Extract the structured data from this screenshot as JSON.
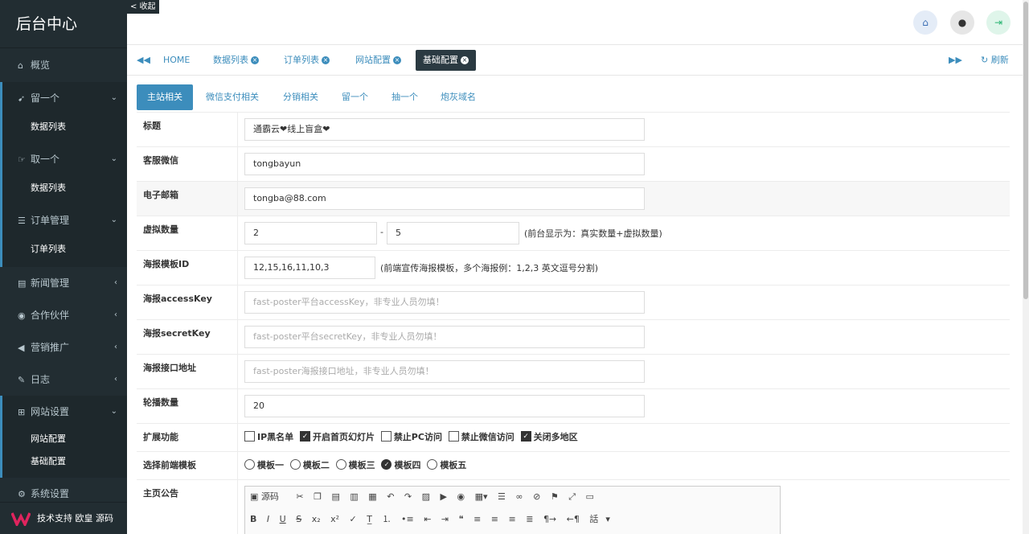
{
  "sidebar": {
    "brand": "后台中心",
    "items": [
      {
        "label": "概览",
        "icon": "home-icon"
      },
      {
        "label": "留一个",
        "icon": "paper-plane-icon",
        "sub": "数据列表"
      },
      {
        "label": "取一个",
        "icon": "hand-icon",
        "sub": "数据列表"
      },
      {
        "label": "订单管理",
        "icon": "list-icon",
        "sub": "订单列表"
      },
      {
        "label": "新闻管理",
        "icon": "newspaper-icon"
      },
      {
        "label": "合作伙伴",
        "icon": "eye-icon"
      },
      {
        "label": "营销推广",
        "icon": "megaphone-icon"
      },
      {
        "label": "日志",
        "icon": "edit-icon"
      },
      {
        "label": "网站设置",
        "icon": "sitemap-icon",
        "subs": [
          "网站配置",
          "基础配置"
        ]
      },
      {
        "label": "系统设置",
        "icon": "gear-icon"
      }
    ],
    "footer": "技术支持 欧皇 源码"
  },
  "header": {
    "collapse": "< 收起"
  },
  "tabs": {
    "home": "HOME",
    "items": [
      "数据列表",
      "订单列表",
      "网站配置",
      "基础配置"
    ],
    "refresh": "刷新"
  },
  "subtabs": [
    "主站相关",
    "微信支付相关",
    "分销相关",
    "留一个",
    "抽一个",
    "炮灰域名"
  ],
  "form": {
    "title": {
      "label": "标题",
      "value": "通霸云❤线上盲盒❤"
    },
    "wechat": {
      "label": "客服微信",
      "value": "tongbayun"
    },
    "email": {
      "label": "电子邮箱",
      "value": "tongba@88.com"
    },
    "virtual": {
      "label": "虚拟数量",
      "min": "2",
      "sep": "-",
      "max": "5",
      "note": "(前台显示为：真实数量+虚拟数量)"
    },
    "poster_id": {
      "label": "海报模板ID",
      "value": "12,15,16,11,10,3",
      "note": "(前端宣传海报模板，多个海报例：1,2,3 英文逗号分割)"
    },
    "access_key": {
      "label": "海报accessKey",
      "placeholder": "fast-poster平台accessKey，非专业人员勿填！"
    },
    "secret_key": {
      "label": "海报secretKey",
      "placeholder": "fast-poster平台secretKey，非专业人员勿填！"
    },
    "poster_api": {
      "label": "海报接口地址",
      "placeholder": "fast-poster海报接口地址，非专业人员勿填！"
    },
    "carousel": {
      "label": "轮播数量",
      "value": "20"
    },
    "extensions": {
      "label": "扩展功能",
      "options": [
        {
          "text": "IP黑名单",
          "checked": false
        },
        {
          "text": "开启首页幻灯片",
          "checked": true
        },
        {
          "text": "禁止PC访问",
          "checked": false
        },
        {
          "text": "禁止微信访问",
          "checked": false
        },
        {
          "text": "关闭多地区",
          "checked": true
        }
      ]
    },
    "template": {
      "label": "选择前端模板",
      "options": [
        {
          "text": "模板一",
          "checked": false
        },
        {
          "text": "模板二",
          "checked": false
        },
        {
          "text": "模板三",
          "checked": false
        },
        {
          "text": "模板四",
          "checked": true
        },
        {
          "text": "模板五",
          "checked": false
        }
      ]
    },
    "notice": {
      "label": "主页公告",
      "source_btn": "源码",
      "heading_btn": "話"
    }
  },
  "colors": {
    "sidebar": "#222d32",
    "accent": "#3c8dbc"
  }
}
